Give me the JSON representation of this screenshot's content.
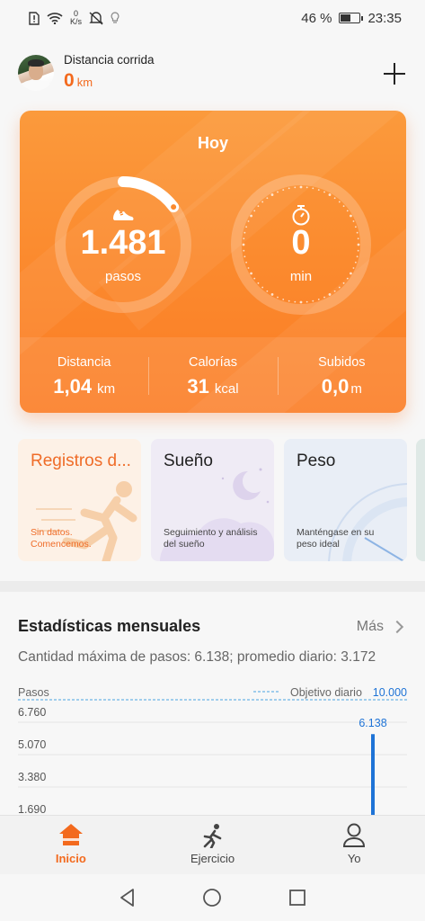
{
  "status_bar": {
    "speed": "0",
    "speed_unit": "K/s",
    "battery": "46 %",
    "battery_fraction": 0.46,
    "time": "23:35"
  },
  "header": {
    "title": "Distancia corrida",
    "value": "0",
    "unit": "km",
    "add_icon": "plus-icon"
  },
  "today": {
    "title": "Hoy",
    "steps_value": "1.481",
    "steps_label": "pasos",
    "steps_progress": 0.148,
    "minutes_value": "0",
    "minutes_label": "min",
    "stats": [
      {
        "label": "Distancia",
        "value": "1,04",
        "unit": "km"
      },
      {
        "label": "Calorías",
        "value": "31",
        "unit": "kcal"
      },
      {
        "label": "Subidos",
        "value": "0,0",
        "unit": "m"
      }
    ]
  },
  "tiles": [
    {
      "title": "Registros d...",
      "subtitle_line1": "Sin datos.",
      "subtitle_line2": "Comencemos."
    },
    {
      "title": "Sueño",
      "subtitle_line1": "Seguimiento y análisis",
      "subtitle_line2": "del sueño"
    },
    {
      "title": "Peso",
      "subtitle_line1": "Manténgase en su",
      "subtitle_line2": "peso ideal"
    }
  ],
  "monthly": {
    "title": "Estadísticas mensuales",
    "more": "Más",
    "summary": "Cantidad máxima de pasos: 6.138; promedio diario: 3.172"
  },
  "chart_data": {
    "type": "bar",
    "ylabel": "Pasos",
    "goal_label": "Objetivo diario",
    "goal_value": "10.000",
    "goal": 10000,
    "ticks": [
      "6.760",
      "5.070",
      "3.380",
      "1.690"
    ],
    "tick_values": [
      6760,
      5070,
      3380,
      1690
    ],
    "ylim": [
      0,
      6760
    ],
    "bars": [
      {
        "value": 6138,
        "label": "6.138"
      }
    ],
    "colors": {
      "bar": "#1e73d6",
      "goal": "#4aa3e0"
    }
  },
  "bottom_nav": [
    {
      "label": "Inicio",
      "icon": "home-icon",
      "active": true
    },
    {
      "label": "Ejercicio",
      "icon": "running-icon",
      "active": false
    },
    {
      "label": "Yo",
      "icon": "person-icon",
      "active": false
    }
  ],
  "colors": {
    "accent": "#f36a1e",
    "card_top": "#fb9a3c",
    "card_bottom": "#fb7c24"
  }
}
